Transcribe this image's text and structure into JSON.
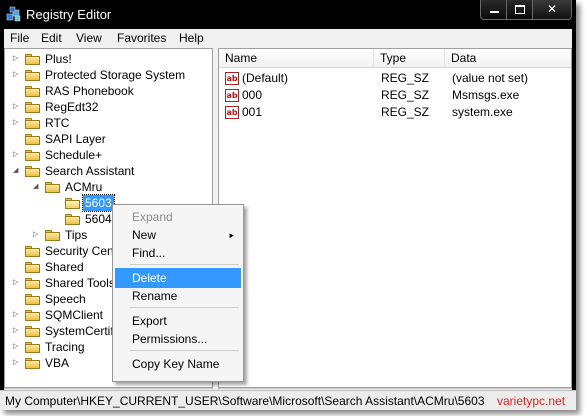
{
  "window": {
    "title": "Registry Editor"
  },
  "titlebar_buttons": {
    "close": "✕"
  },
  "menubar": [
    "File",
    "Edit",
    "View",
    "Favorites",
    "Help"
  ],
  "tree": {
    "items": [
      {
        "label": "Plus!",
        "indent": 0,
        "expander": "▷"
      },
      {
        "label": "Protected Storage System",
        "indent": 0,
        "expander": "▷"
      },
      {
        "label": "RAS Phonebook",
        "indent": 0,
        "expander": ""
      },
      {
        "label": "RegEdt32",
        "indent": 0,
        "expander": "▷"
      },
      {
        "label": "RTC",
        "indent": 0,
        "expander": "▷"
      },
      {
        "label": "SAPI Layer",
        "indent": 0,
        "expander": ""
      },
      {
        "label": "Schedule+",
        "indent": 0,
        "expander": "▷"
      },
      {
        "label": "Search Assistant",
        "indent": 0,
        "expander": "◢"
      },
      {
        "label": "ACMru",
        "indent": 1,
        "expander": "◢"
      },
      {
        "label": "5603",
        "indent": 2,
        "expander": "",
        "selected": true
      },
      {
        "label": "5604",
        "indent": 2,
        "expander": ""
      },
      {
        "label": "Tips",
        "indent": 1,
        "expander": "▷"
      },
      {
        "label": "Security Center",
        "indent": 0,
        "expander": ""
      },
      {
        "label": "Shared",
        "indent": 0,
        "expander": ""
      },
      {
        "label": "Shared Tools",
        "indent": 0,
        "expander": "▷"
      },
      {
        "label": "Speech",
        "indent": 0,
        "expander": ""
      },
      {
        "label": "SQMClient",
        "indent": 0,
        "expander": "▷"
      },
      {
        "label": "SystemCertificates",
        "indent": 0,
        "expander": "▷"
      },
      {
        "label": "Tracing",
        "indent": 0,
        "expander": "▷"
      },
      {
        "label": "VBA",
        "indent": 0,
        "expander": "▷"
      }
    ]
  },
  "list": {
    "columns": [
      "Name",
      "Type",
      "Data"
    ],
    "rows": [
      {
        "icon": "ab",
        "name": "(Default)",
        "type": "REG_SZ",
        "data": "(value not set)"
      },
      {
        "icon": "ab",
        "name": "000",
        "type": "REG_SZ",
        "data": "Msmsgs.exe"
      },
      {
        "icon": "ab",
        "name": "001",
        "type": "REG_SZ",
        "data": "system.exe"
      }
    ]
  },
  "context_menu": {
    "items": [
      {
        "label": "Expand",
        "disabled": true
      },
      {
        "label": "New",
        "submenu": "▸"
      },
      {
        "label": "Find..."
      },
      {
        "separator": true
      },
      {
        "label": "Delete",
        "highlighted": true
      },
      {
        "label": "Rename"
      },
      {
        "separator": true
      },
      {
        "label": "Export"
      },
      {
        "label": "Permissions..."
      },
      {
        "separator": true
      },
      {
        "label": "Copy Key Name"
      }
    ]
  },
  "statusbar": {
    "path": "My Computer\\HKEY_CURRENT_USER\\Software\\Microsoft\\Search Assistant\\ACMru\\5603"
  },
  "watermark": "varietypc.net",
  "colors": {
    "selection": "#3399ff",
    "folder": "#e9c24b",
    "titlebar": "#000000",
    "watermark": "#e0211d"
  },
  "icons": {
    "app": "registry-editor-icon",
    "folder": "folder-icon",
    "string_value": "string-value-icon"
  }
}
